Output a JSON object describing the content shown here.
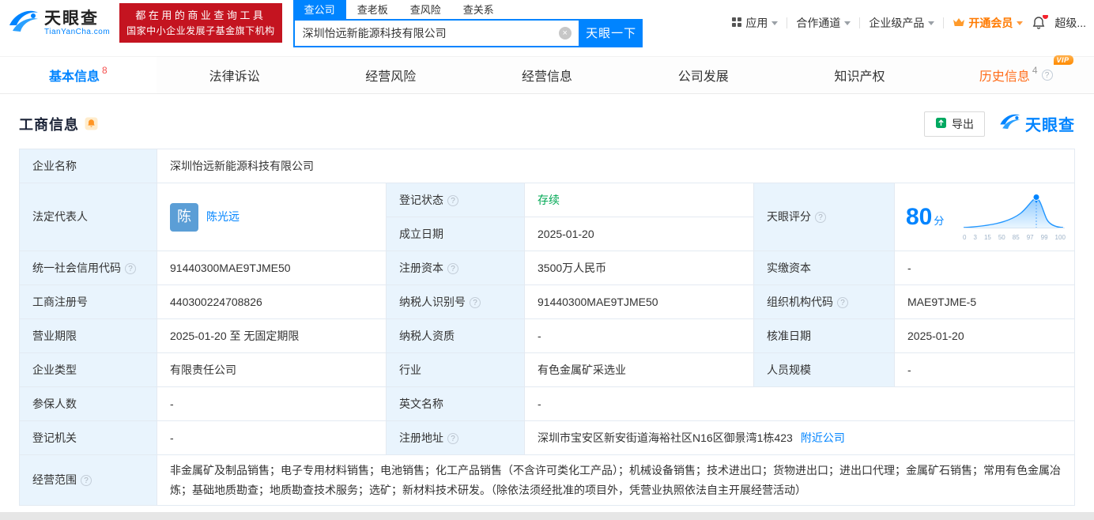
{
  "header": {
    "logo": {
      "brand": "天眼查",
      "domain": "TianYanCha.com"
    },
    "promo": {
      "line1": "都在用的商业查询工具",
      "line2": "国家中小企业发展子基金旗下机构"
    },
    "search_tabs": [
      {
        "label": "查公司",
        "active": true
      },
      {
        "label": "查老板",
        "active": false
      },
      {
        "label": "查风险",
        "active": false
      },
      {
        "label": "查关系",
        "active": false
      }
    ],
    "search": {
      "value": "深圳怡远新能源科技有限公司",
      "button_label": "天眼一下"
    },
    "menu": {
      "apps": "应用",
      "partner": "合作通道",
      "enterprise": "企业级产品",
      "vip": "开通会员",
      "super": "超级..."
    }
  },
  "nav_tabs": [
    {
      "label": "基本信息",
      "badge": "8",
      "active": true
    },
    {
      "label": "法律诉讼"
    },
    {
      "label": "经营风险"
    },
    {
      "label": "经营信息"
    },
    {
      "label": "公司发展"
    },
    {
      "label": "知识产权"
    },
    {
      "label": "历史信息",
      "badge": "4",
      "tag": "VIP"
    }
  ],
  "section": {
    "title": "工商信息",
    "export_label": "导出",
    "brand": "天眼查"
  },
  "info": {
    "company_name": {
      "label": "企业名称",
      "value": "深圳怡远新能源科技有限公司"
    },
    "legal_rep": {
      "label": "法定代表人",
      "avatar": "陈",
      "value": "陈光远"
    },
    "reg_status": {
      "label": "登记状态",
      "value": "存续"
    },
    "established": {
      "label": "成立日期",
      "value": "2025-01-20"
    },
    "score": {
      "label": "天眼评分",
      "value": "80",
      "unit": "分"
    },
    "credit_code": {
      "label": "统一社会信用代码",
      "value": "91440300MAE9TJME50"
    },
    "reg_capital": {
      "label": "注册资本",
      "value": "3500万人民币"
    },
    "paid_capital": {
      "label": "实缴资本",
      "value": "-"
    },
    "reg_no": {
      "label": "工商注册号",
      "value": "440300224708826"
    },
    "tax_id": {
      "label": "纳税人识别号",
      "value": "91440300MAE9TJME50"
    },
    "org_code": {
      "label": "组织机构代码",
      "value": "MAE9TJME-5"
    },
    "term": {
      "label": "营业期限",
      "value": "2025-01-20 至 无固定期限"
    },
    "taxpayer_quality": {
      "label": "纳税人资质",
      "value": "-"
    },
    "approval_date": {
      "label": "核准日期",
      "value": "2025-01-20"
    },
    "company_type": {
      "label": "企业类型",
      "value": "有限责任公司"
    },
    "industry": {
      "label": "行业",
      "value": "有色金属矿采选业"
    },
    "staff_size": {
      "label": "人员规模",
      "value": "-"
    },
    "insured_count": {
      "label": "参保人数",
      "value": "-"
    },
    "english_name": {
      "label": "英文名称",
      "value": "-"
    },
    "reg_authority": {
      "label": "登记机关",
      "value": "-"
    },
    "address": {
      "label": "注册地址",
      "value": "深圳市宝安区新安街道海裕社区N16区御景湾1栋423",
      "link": "附近公司"
    },
    "business_scope": {
      "label": "经营范围",
      "value": "非金属矿及制品销售；电子专用材料销售；电池销售；化工产品销售（不含许可类化工产品）；机械设备销售；技术进出口；货物进出口；进出口代理；金属矿石销售；常用有色金属冶炼；基础地质勘查；地质勘查技术服务；选矿；新材料技术研发。（除依法须经批准的项目外，凭营业执照依法自主开展经营活动）"
    }
  },
  "chart_data": {
    "type": "area",
    "title": "天眼评分分布曲线",
    "score_marker": 80,
    "x_ticks": [
      "0",
      "3",
      "15",
      "50",
      "85",
      "97",
      "99",
      "100"
    ]
  },
  "icons": {
    "help": "?",
    "clear": "×",
    "chevron_down": "▾"
  },
  "colors": {
    "brand_blue": "#0084ff",
    "promo_red": "#c41420",
    "status_green": "#00a854",
    "vip_orange": "#ff7a00",
    "history_orange": "#ff6d1a",
    "label_bg": "#e9f4fd"
  }
}
